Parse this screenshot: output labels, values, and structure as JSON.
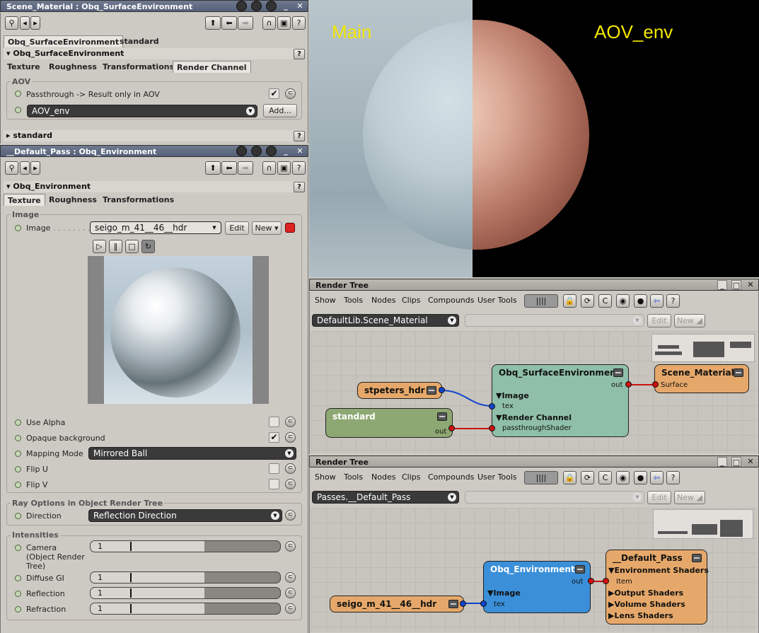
{
  "ppg1": {
    "title": "Scene_Material : Obq_SurfaceEnvironment",
    "tabs": [
      "Obq_SurfaceEnvironment",
      "standard"
    ],
    "section": "Obq_SurfaceEnvironment",
    "subtabs": [
      "Texture",
      "Roughness",
      "Transformations",
      "Render Channel"
    ],
    "group_aov": "AOV",
    "passthrough_label": "Passthrough -> Result only in AOV",
    "passthrough_checked": true,
    "aov_value": "AOV_env",
    "add_label": "Add...",
    "collapsed_section": "standard"
  },
  "ppg2": {
    "title": "__Default_Pass : Obq_Environment",
    "section": "Obq_Environment",
    "subtabs": [
      "Texture",
      "Roughness",
      "Transformations"
    ],
    "group_image": "Image",
    "image_label": "Image",
    "image_value": "seigo_m_41__46__hdr",
    "edit_label": "Edit",
    "new_label": "New",
    "use_alpha_label": "Use Alpha",
    "use_alpha_checked": false,
    "opaque_label": "Opaque background",
    "opaque_checked": true,
    "mapping_label": "Mapping Mode",
    "mapping_value": "Mirrored Ball",
    "flipu_label": "Flip U",
    "flipv_label": "Flip V",
    "group_ray": "Ray Options in Object Render Tree",
    "direction_label": "Direction",
    "direction_value": "Reflection Direction",
    "group_int": "Intensities",
    "camera_label": "Camera",
    "camera_sub1": "(Object Render",
    "camera_sub2": "Tree)",
    "camera_value": "1",
    "diffuse_label": "Diffuse GI",
    "diffuse_value": "1",
    "reflection_label": "Reflection",
    "reflection_value": "1",
    "refraction_label": "Refraction",
    "refraction_value": "1",
    "slider_fill": 0.6
  },
  "viewport": {
    "left_label": "Main",
    "right_label": "AOV_env",
    "label_color": "#f2e600"
  },
  "rt1": {
    "title": "Render Tree",
    "menu": [
      "Show",
      "Tools",
      "Nodes",
      "Clips",
      "Compounds",
      "User Tools"
    ],
    "path": "DefaultLib.Scene_Material",
    "edit_label": "Edit",
    "new_label": "New",
    "nodes": {
      "stpeters": "stpeters_hdr",
      "standard": "standard",
      "standard_out": "out",
      "obq": "Obq_SurfaceEnvironment",
      "obq_out": "out",
      "obq_image": "Image",
      "obq_tex": "tex",
      "obq_rc": "Render Channel",
      "obq_pass": "passthroughShader",
      "scene": "Scene_Material",
      "scene_surface": "Surface"
    }
  },
  "rt2": {
    "title": "Render Tree",
    "menu": [
      "Show",
      "Tools",
      "Nodes",
      "Clips",
      "Compounds",
      "User Tools"
    ],
    "path": "Passes.__Default_Pass",
    "edit_label": "Edit",
    "new_label": "New",
    "nodes": {
      "seigo": "seigo_m_41__46__hdr",
      "env": "Obq_Environment",
      "env_out": "out",
      "env_image": "Image",
      "env_tex": "tex",
      "pass": "__Default_Pass",
      "pass_env": "Environment Shaders",
      "pass_item": "Item",
      "pass_output": "Output Shaders",
      "pass_volume": "Volume Shaders",
      "pass_lens": "Lens Shaders"
    }
  },
  "colors": {
    "node_orange": "#e6a86a",
    "node_green": "#8ea873",
    "node_teal": "#8fbfa8",
    "node_blue": "#3a8fd8",
    "wire_red": "#cc1111",
    "wire_blue": "#1144cc"
  }
}
